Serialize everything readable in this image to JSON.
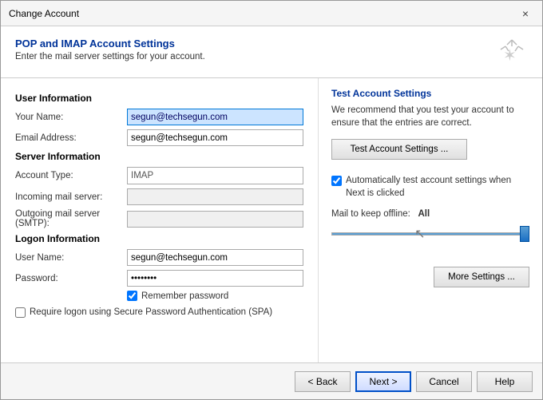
{
  "window": {
    "title": "Change Account",
    "close_label": "×"
  },
  "header": {
    "title": "POP and IMAP Account Settings",
    "subtitle": "Enter the mail server settings for your account.",
    "icon": "✶"
  },
  "left": {
    "user_info_title": "User Information",
    "your_name_label": "Your Name:",
    "your_name_value": "segun@techsegun.com",
    "email_address_label": "Email Address:",
    "email_address_value": "segun@techsegun.com",
    "server_info_title": "Server Information",
    "account_type_label": "Account Type:",
    "account_type_value": "IMAP",
    "incoming_label": "Incoming mail server:",
    "incoming_value": "",
    "outgoing_label": "Outgoing mail server (SMTP):",
    "outgoing_value": "",
    "logon_info_title": "Logon Information",
    "username_label": "User Name:",
    "username_value": "segun@techsegun.com",
    "password_label": "Password:",
    "password_value": "••••••••",
    "remember_label": "Remember password",
    "spa_label": "Require logon using Secure Password Authentication (SPA)"
  },
  "right": {
    "title": "Test Account Settings",
    "description": "We recommend that you test your account to ensure that the entries are correct.",
    "test_btn_label": "Test Account Settings ...",
    "auto_test_label": "Automatically test account settings when Next is clicked",
    "mail_offline_label": "Mail to keep offline:",
    "mail_offline_value": "All",
    "more_settings_label": "More Settings ..."
  },
  "footer": {
    "back_label": "< Back",
    "next_label": "Next >",
    "cancel_label": "Cancel",
    "help_label": "Help"
  }
}
